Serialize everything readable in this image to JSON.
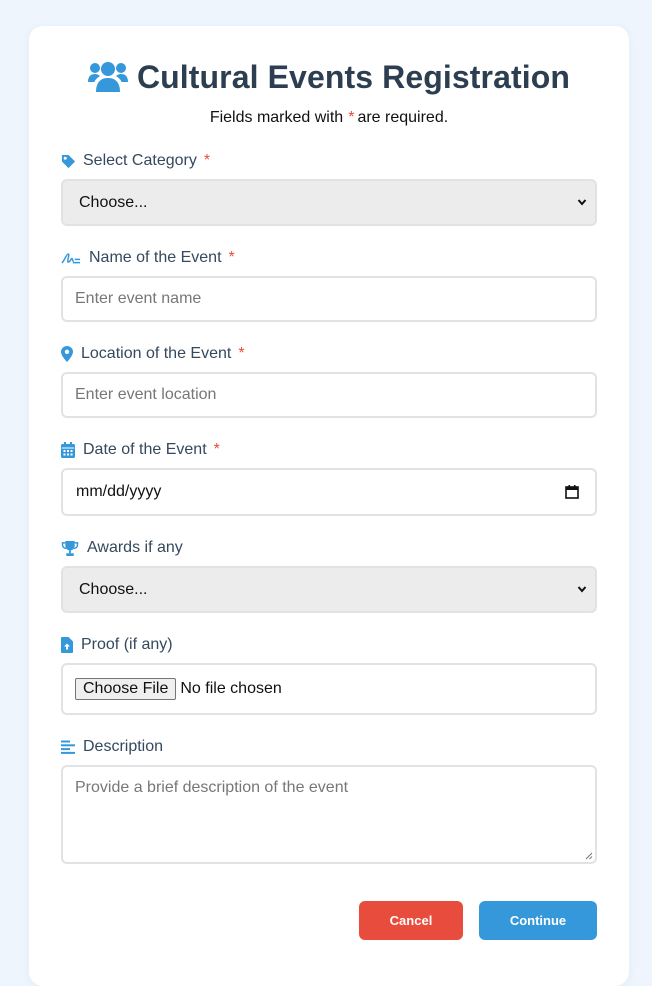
{
  "form": {
    "title": "Cultural Events Registration",
    "title_icon": "users-icon",
    "subtitle_before": "Fields marked with",
    "required_mark": "*",
    "subtitle_after": "are required."
  },
  "fields": {
    "category": {
      "label": "Select Category",
      "icon": "tag-icon",
      "required": true,
      "value": "Choose..."
    },
    "event_name": {
      "label": "Name of the Event",
      "icon": "signature-icon",
      "required": true,
      "placeholder": "Enter event name"
    },
    "location": {
      "label": "Location of the Event",
      "icon": "map-marker-icon",
      "required": true,
      "placeholder": "Enter event location"
    },
    "date": {
      "label": "Date of the Event",
      "icon": "calendar-icon",
      "required": true,
      "value": "mm/dd/yyyy"
    },
    "awards": {
      "label": "Awards if any",
      "icon": "trophy-icon",
      "required": false,
      "value": "Choose..."
    },
    "proof": {
      "label": "Proof (if any)",
      "icon": "file-upload-icon",
      "required": false,
      "button_label": "Choose File",
      "status": "No file chosen"
    },
    "description": {
      "label": "Description",
      "icon": "align-left-icon",
      "required": false,
      "placeholder": "Provide a brief description of the event"
    }
  },
  "actions": {
    "cancel_label": "Cancel",
    "continue_label": "Continue"
  },
  "colors": {
    "accent": "#3498db",
    "danger": "#e74c3c",
    "heading": "#2c3e50",
    "page_background": "#eef5fd"
  }
}
